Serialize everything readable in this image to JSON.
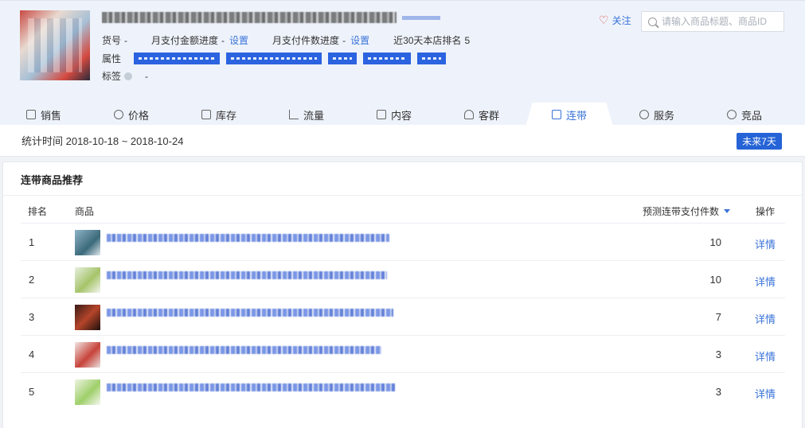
{
  "product": {
    "sku_label": "货号",
    "sku_value": "-",
    "pay_amount_label": "月支付金额进度",
    "pay_amount_value": "-",
    "pay_amount_link": "设置",
    "pay_count_label": "月支付件数进度",
    "pay_count_value": "-",
    "pay_count_link": "设置",
    "rank_label": "近30天本店排名",
    "rank_value": "5",
    "attr_label": "属性",
    "tag_label": "标签",
    "tag_value": "-"
  },
  "header": {
    "follow_label": "关注",
    "search_placeholder": "请输入商品标题、商品ID"
  },
  "tabs": [
    {
      "label": "销售",
      "icon": "bag-icon"
    },
    {
      "label": "价格",
      "icon": "yen-icon"
    },
    {
      "label": "库存",
      "icon": "warehouse-icon"
    },
    {
      "label": "流量",
      "icon": "line-chart-icon"
    },
    {
      "label": "内容",
      "icon": "document-icon"
    },
    {
      "label": "客群",
      "icon": "people-icon"
    },
    {
      "label": "连带",
      "icon": "link-icon",
      "active": true
    },
    {
      "label": "服务",
      "icon": "headset-icon"
    },
    {
      "label": "竞品",
      "icon": "vs-icon"
    }
  ],
  "stats": {
    "period_text": "统计时间 2018-10-18 ~ 2018-10-24",
    "future_button": "未来7天"
  },
  "recommend": {
    "title": "连带商品推荐",
    "col_rank": "排名",
    "col_product": "商品",
    "col_metric": "预测连带支付件数",
    "col_op": "操作",
    "rows": [
      {
        "rank": "1",
        "value": "10",
        "action": "详情"
      },
      {
        "rank": "2",
        "value": "10",
        "action": "详情"
      },
      {
        "rank": "3",
        "value": "7",
        "action": "详情"
      },
      {
        "rank": "4",
        "value": "3",
        "action": "详情"
      },
      {
        "rank": "5",
        "value": "3",
        "action": "详情"
      }
    ]
  },
  "colors": {
    "accent": "#3a73d9",
    "button": "#2563d6",
    "header_bg": "#eef3fb"
  }
}
